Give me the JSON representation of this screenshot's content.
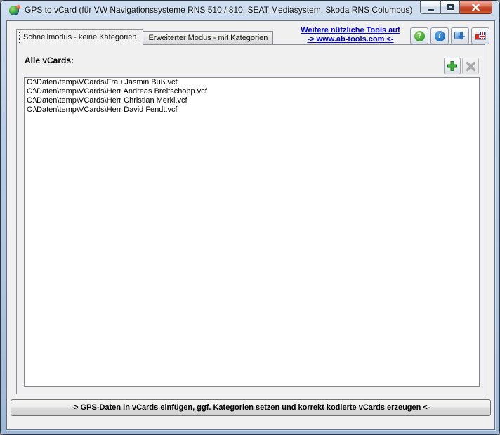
{
  "window": {
    "title": "GPS to vCard (für VW Navigationssysteme RNS 510 / 810, SEAT Mediasystem, Skoda RNS Columbus)"
  },
  "tabs": [
    {
      "label": "Schnellmodus - keine Kategorien",
      "active": true
    },
    {
      "label": "Erweiterter Modus - mit Kategorien",
      "active": false
    }
  ],
  "link": {
    "line1": "Weitere nützliche Tools auf",
    "line2": "-> www.ab-tools.com <-"
  },
  "toolbar": {
    "help_glyph": "?",
    "info_glyph": "i",
    "icons": [
      "help-icon",
      "info-icon",
      "update-download-icon",
      "language-flag-icon"
    ]
  },
  "panel": {
    "label": "Alle vCards:"
  },
  "list": {
    "items": [
      "C:\\Daten\\temp\\VCards\\Frau Jasmin Buß.vcf",
      "C:\\Daten\\temp\\VCards\\Herr Andreas Breitschopp.vcf",
      "C:\\Daten\\temp\\VCards\\Herr Christian Merkl.vcf",
      "C:\\Daten\\temp\\VCards\\Herr David Fendt.vcf"
    ]
  },
  "action_button": {
    "label": "-> GPS-Daten in vCards einfügen, ggf. Kategorien setzen und korrekt kodierte vCards erzeugen <-"
  },
  "colors": {
    "frame_blue": "#b9cde4",
    "client_bg": "#f0f0f0",
    "link_blue": "#0000e8",
    "close_red": "#bf3e22",
    "add_green": "#2fae2f",
    "remove_gray": "#a9a9a9"
  }
}
